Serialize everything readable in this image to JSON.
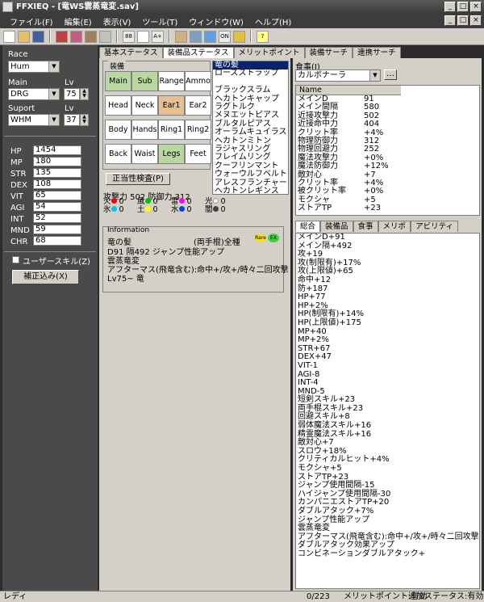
{
  "window": {
    "title": "FFXIEQ - [竜WS雲蒸竜変.sav]",
    "min": "_",
    "max": "□",
    "close": "×"
  },
  "menu": [
    "ファイル(F)",
    "編集(E)",
    "表示(V)",
    "ツール(T)",
    "ウィンドウ(W)",
    "ヘルプ(H)"
  ],
  "toolbar": {
    "icons": [
      "new-icon",
      "open-icon",
      "save-icon",
      "equip-icon",
      "equip2-icon",
      "equip3-icon",
      "grid-icon",
      "b8-icon",
      "aa-icon",
      "aplus-icon",
      "home-icon",
      "settings-icon",
      "target-icon",
      "on-icon",
      "food-icon",
      "help-icon"
    ],
    "labels": [
      "88",
      "A+",
      "ON"
    ]
  },
  "left": {
    "race_label": "Race",
    "race": "Hum",
    "main_label": "Main",
    "main": "DRG",
    "lv_label": "Lv",
    "main_lv": "75",
    "suport_label": "Suport",
    "suport": "WHM",
    "sup_lv_label": "Lv",
    "sup_lv": "37",
    "stats": [
      {
        "k": "HP",
        "v": "1454"
      },
      {
        "k": "MP",
        "v": "180"
      },
      {
        "k": "STR",
        "v": "135"
      },
      {
        "k": "DEX",
        "v": "108"
      },
      {
        "k": "VIT",
        "v": "65"
      },
      {
        "k": "AGI",
        "v": "54"
      },
      {
        "k": "INT",
        "v": "52"
      },
      {
        "k": "MND",
        "v": "59"
      },
      {
        "k": "CHR",
        "v": "68"
      }
    ],
    "user_skill": "ユーザースキル(Z)",
    "correction": "補正込み(X)"
  },
  "mid": {
    "tabs": [
      "基本ステータス",
      "装備品ステータス",
      "メリットポイント",
      "装備サーチ",
      "連携サーチ"
    ],
    "equip_label": "装備",
    "slots": [
      "Main",
      "Sub",
      "Range",
      "Ammo",
      "Head",
      "Neck",
      "Ear1",
      "Ear2",
      "Body",
      "Hands",
      "Ring1",
      "Ring2",
      "Back",
      "Waist",
      "Legs",
      "Feet"
    ],
    "list": [
      "竜の髪",
      "ローズストラップ",
      "",
      "ブラックスラム",
      "ヘカトンキャップ",
      "ラグトルク",
      "メヌエットピアス",
      "ブルタルピアス",
      "オーラムキュイラス",
      "ヘカトンミトン",
      "ラジャスリング",
      "フレイムリング",
      "クーフリンマント",
      "ウォーウルフベルト",
      "アレスフランチャー",
      "ヘカトンレギンス"
    ],
    "check_btn": "正当性検査(P)",
    "atk_def": "攻撃力 502 防御力 312",
    "elements": [
      {
        "name": "火",
        "v": "0",
        "color": "#ff0000"
      },
      {
        "name": "風",
        "v": "0",
        "color": "#00c000"
      },
      {
        "name": "雷",
        "v": "0",
        "color": "#ff00ff"
      },
      {
        "name": "光",
        "v": "0",
        "color": "#ffffff"
      },
      {
        "name": "氷",
        "v": "0",
        "color": "#00c0ff"
      },
      {
        "name": "土",
        "v": "0",
        "color": "#ffff00"
      },
      {
        "name": "水",
        "v": "0",
        "color": "#0040ff"
      },
      {
        "name": "闇",
        "v": "0",
        "color": "#404040"
      }
    ],
    "info_label": "Information",
    "info_name": "竜の髪",
    "info_type": "(両手棍)全種",
    "info_line1": "D91 隔492 ジャンプ性能アップ",
    "info_line2": "雲蒸竜変",
    "info_line3": "アフターマス(飛竜含む):命中+/攻+/時々二回攻撃",
    "info_line4": "Lv75~ 竜",
    "rare": "Rare",
    "ex": "EX"
  },
  "right": {
    "food_label": "食事(J)",
    "food": "カルボナーラ",
    "table_header": "Name",
    "food_stats": [
      {
        "k": "メインD",
        "v": "91"
      },
      {
        "k": "メイン間隔",
        "v": "580"
      },
      {
        "k": "近接攻撃力",
        "v": "502"
      },
      {
        "k": "近接命中力",
        "v": "404"
      },
      {
        "k": "クリット率",
        "v": "+4%"
      },
      {
        "k": "物理防御力",
        "v": "312"
      },
      {
        "k": "物理回避力",
        "v": "252"
      },
      {
        "k": "魔法攻撃力",
        "v": "+0%"
      },
      {
        "k": "魔法防御力",
        "v": "+12%"
      },
      {
        "k": "敵対心",
        "v": "+7"
      },
      {
        "k": "クリット率",
        "v": "+4%"
      },
      {
        "k": "被クリット率",
        "v": "+0%"
      },
      {
        "k": "モクシャ",
        "v": "+5"
      },
      {
        "k": "ストアTP",
        "v": "+23"
      }
    ],
    "tabs": [
      "総合",
      "装備品",
      "食事",
      "メリポ",
      "アビリティ"
    ],
    "summary": [
      "メインD+91",
      "メイン隔+492",
      "攻+19",
      "攻(制限有)+17%",
      "攻(上限値)+65",
      "命中+12",
      "防+187",
      "HP+77",
      "HP+2%",
      "HP(制限有)+14%",
      "HP(上限値)+175",
      "MP+40",
      "MP+2%",
      "STR+67",
      "DEX+47",
      "VIT-1",
      "AGI-8",
      "INT-4",
      "MND-5",
      "短剣スキル+23",
      "両手棍スキル+23",
      "回避スキル+8",
      "弱体魔法スキル+16",
      "精霊魔法スキル+16",
      "敵対心+7",
      "スロウ+18%",
      "クリティカルヒット+4%",
      "モクシャ+5",
      "ストアTP+23",
      "ジャンプ使用間隔-15",
      "ハイジャンプ使用間隔-30",
      "カンパニエストアTP+20",
      "ダブルアタック+7%",
      "ジャンプ性能アップ",
      "雲蒸竜変",
      "アフターマス(飛竜含む):命中+/攻+/時々二回攻撃",
      "ダブルアタック効果アップ",
      "コンビネーションダブルアタック+"
    ]
  },
  "status": {
    "left": "レディ",
    "count": "0/223",
    "merit": "メリットポイント:有効",
    "extra": "追加ステータス:有効"
  }
}
